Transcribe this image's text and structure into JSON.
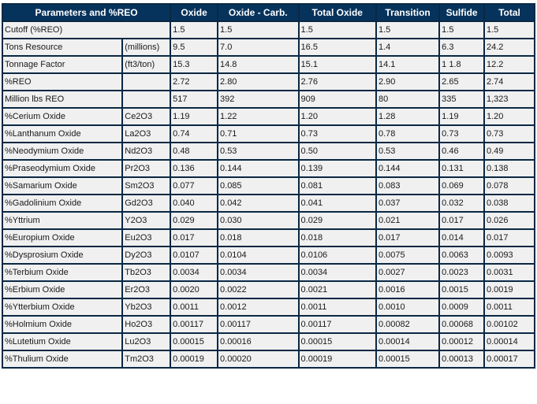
{
  "table": {
    "header": {
      "parameters": "Parameters and %REO",
      "columns": [
        "Oxide",
        "Oxide - Carb.",
        "Total Oxide",
        "Transition",
        "Sulfide",
        "Total"
      ]
    },
    "rows": [
      {
        "label": "Cutoff (%REO)",
        "unit": "",
        "span": true,
        "values": [
          "1.5",
          "1.5",
          "1.5",
          "1.5",
          "1.5",
          "1.5"
        ]
      },
      {
        "label": "Tons Resource",
        "unit": "(millions)",
        "values": [
          "9.5",
          "7.0",
          "16.5",
          "1.4",
          "6.3",
          "24.2"
        ]
      },
      {
        "label": "Tonnage Factor",
        "unit": "(ft3/ton)",
        "values": [
          "15.3",
          "14.8",
          "15.1",
          "14.1",
          "1 1.8",
          "12.2"
        ]
      },
      {
        "label": "%REO",
        "unit": "",
        "values": [
          "2.72",
          "2.80",
          "2.76",
          "2.90",
          "2.65",
          "2.74"
        ]
      },
      {
        "label": "Million lbs REO",
        "unit": "",
        "values": [
          "517",
          "392",
          "909",
          "80",
          "335",
          "1,323"
        ]
      },
      {
        "label": "%Cerium Oxide",
        "unit": "Ce2O3",
        "values": [
          "1.19",
          "1.22",
          "1.20",
          "1.28",
          "1.19",
          "1.20"
        ]
      },
      {
        "label": "%Lanthanum Oxide",
        "unit": "La2O3",
        "values": [
          "0.74",
          "0.71",
          "0.73",
          "0.78",
          "0.73",
          "0.73"
        ]
      },
      {
        "label": "%Neodymium Oxide",
        "unit": "Nd2O3",
        "values": [
          "0.48",
          "0.53",
          "0.50",
          "0.53",
          "0.46",
          "0.49"
        ]
      },
      {
        "label": "%Praseodymium Oxide",
        "unit": "Pr2O3",
        "values": [
          "0.136",
          "0.144",
          "0.139",
          "0.144",
          "0.131",
          "0.138"
        ]
      },
      {
        "label": "%Samarium Oxide",
        "unit": "Sm2O3",
        "values": [
          "0.077",
          "0.085",
          "0.081",
          "0.083",
          "0.069",
          "0.078"
        ]
      },
      {
        "label": "%Gadolinium Oxide",
        "unit": "Gd2O3",
        "values": [
          "0.040",
          "0.042",
          "0.041",
          "0.037",
          "0.032",
          "0.038"
        ]
      },
      {
        "label": "%Yttrium",
        "unit": "Y2O3",
        "values": [
          "0.029",
          "0.030",
          "0.029",
          "0.021",
          "0.017",
          "0.026"
        ]
      },
      {
        "label": "%Europium Oxide",
        "unit": "Eu2O3",
        "values": [
          "0.017",
          "0.018",
          "0.018",
          "0.017",
          "0.014",
          "0.017"
        ]
      },
      {
        "label": "%Dysprosium Oxide",
        "unit": "Dy2O3",
        "values": [
          "0.0107",
          "0.0104",
          "0.0106",
          "0.0075",
          "0.0063",
          "0.0093"
        ]
      },
      {
        "label": "%Terbium Oxide",
        "unit": "Tb2O3",
        "values": [
          "0.0034",
          "0.0034",
          "0.0034",
          "0.0027",
          "0.0023",
          "0.0031"
        ]
      },
      {
        "label": "%Erbium Oxide",
        "unit": "Er2O3",
        "values": [
          "0.0020",
          "0.0022",
          "0.0021",
          "0.0016",
          "0.0015",
          "0.0019"
        ]
      },
      {
        "label": "%Ytterbium Oxide",
        "unit": "Yb2O3",
        "values": [
          "0.0011",
          "0.0012",
          "0.0011",
          "0.0010",
          "0.0009",
          "0.0011"
        ]
      },
      {
        "label": "%Holmium Oxide",
        "unit": "Ho2O3",
        "values": [
          "0.00117",
          "0.00117",
          "0.00117",
          "0.00082",
          "0.00068",
          "0.00102"
        ]
      },
      {
        "label": "%Lutetium Oxide",
        "unit": "Lu2O3",
        "values": [
          "0.00015",
          "0.00016",
          "0.00015",
          "0.00014",
          "0.00012",
          "0.00014"
        ]
      },
      {
        "label": "%Thulium Oxide",
        "unit": "Tm2O3",
        "values": [
          "0.00019",
          "0.00020",
          "0.00019",
          "0.00015",
          "0.00013",
          "0.00017"
        ]
      }
    ]
  },
  "colors": {
    "header_bg": "#06335c",
    "header_text": "#ffffff",
    "cell_bg": "#f0f0f0",
    "border": "#0a2844"
  }
}
